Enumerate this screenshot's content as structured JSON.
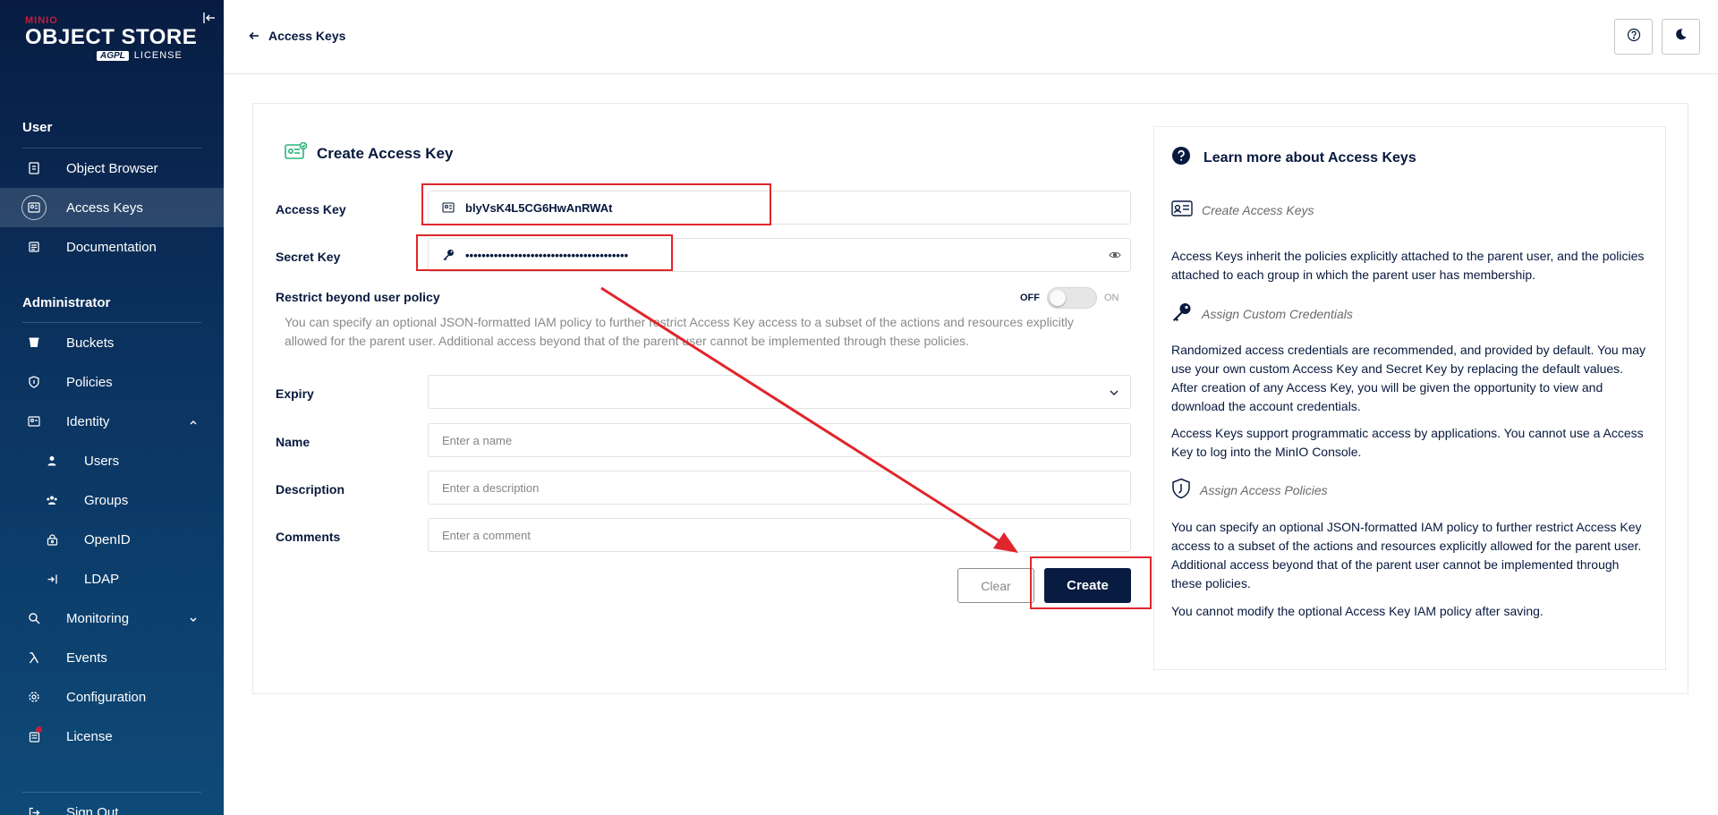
{
  "sidebar": {
    "logo": {
      "brand": "MINIO",
      "product": "OBJECT STORE",
      "license_badge": "AGPL",
      "license_text": "LICENSE"
    },
    "user_section": "User",
    "admin_section": "Administrator",
    "items": {
      "object_browser": "Object Browser",
      "access_keys": "Access Keys",
      "documentation": "Documentation",
      "buckets": "Buckets",
      "policies": "Policies",
      "identity": "Identity",
      "users": "Users",
      "groups": "Groups",
      "openid": "OpenID",
      "ldap": "LDAP",
      "monitoring": "Monitoring",
      "events": "Events",
      "configuration": "Configuration",
      "license": "License",
      "sign_out": "Sign Out"
    }
  },
  "header": {
    "back_label": "Access Keys"
  },
  "form": {
    "title": "Create Access Key",
    "access_key_label": "Access Key",
    "access_key_value": "blyVsK4L5CG6HwAnRWAt",
    "secret_key_label": "Secret Key",
    "secret_key_value": "••••••••••••••••••••••••••••••••••••••••",
    "restrict_label": "Restrict beyond user policy",
    "switch_off": "OFF",
    "switch_on": "ON",
    "restrict_help": "You can specify an optional JSON-formatted IAM policy to further restrict Access Key access to a subset of the actions and resources explicitly allowed for the parent user. Additional access beyond that of the parent user cannot be implemented through these policies.",
    "expiry_label": "Expiry",
    "name_label": "Name",
    "name_placeholder": "Enter a name",
    "description_label": "Description",
    "description_placeholder": "Enter a description",
    "comments_label": "Comments",
    "comments_placeholder": "Enter a comment",
    "clear_label": "Clear",
    "create_label": "Create"
  },
  "info": {
    "title": "Learn more about Access Keys",
    "sub1": "Create Access Keys",
    "para1": "Access Keys inherit the policies explicitly attached to the parent user, and the policies attached to each group in which the parent user has membership.",
    "sub2": "Assign Custom Credentials",
    "para2": "Randomized access credentials are recommended, and provided by default. You may use your own custom Access Key and Secret Key by replacing the default values. After creation of any Access Key, you will be given the opportunity to view and download the account credentials.",
    "para3": "Access Keys support programmatic access by applications. You cannot use a Access Key to log into the MinIO Console.",
    "sub3": "Assign Access Policies",
    "para4": "You can specify an optional JSON-formatted IAM policy to further restrict Access Key access to a subset of the actions and resources explicitly allowed for the parent user. Additional access beyond that of the parent user cannot be implemented through these policies.",
    "para5": "You cannot modify the optional Access Key IAM policy after saving."
  },
  "colors": {
    "sidebar_dark": "#081c42",
    "primary": "#081c42",
    "annotation": "#e0262c",
    "accent_green": "#2db37d",
    "alert_red": "#c51c3f"
  },
  "icons": [
    "collapse-icon",
    "object-browser-icon",
    "access-keys-icon",
    "documentation-icon",
    "buckets-icon",
    "policies-icon",
    "identity-icon",
    "users-icon",
    "groups-icon",
    "openid-icon",
    "ldap-icon",
    "monitoring-icon",
    "events-icon",
    "configuration-icon",
    "license-icon",
    "sign-out-icon",
    "back-arrow-icon",
    "help-icon",
    "dark-mode-icon",
    "access-key-card-icon",
    "key-icon",
    "eye-icon",
    "chevron-down-icon",
    "question-circle-icon",
    "policy-shield-icon"
  ]
}
